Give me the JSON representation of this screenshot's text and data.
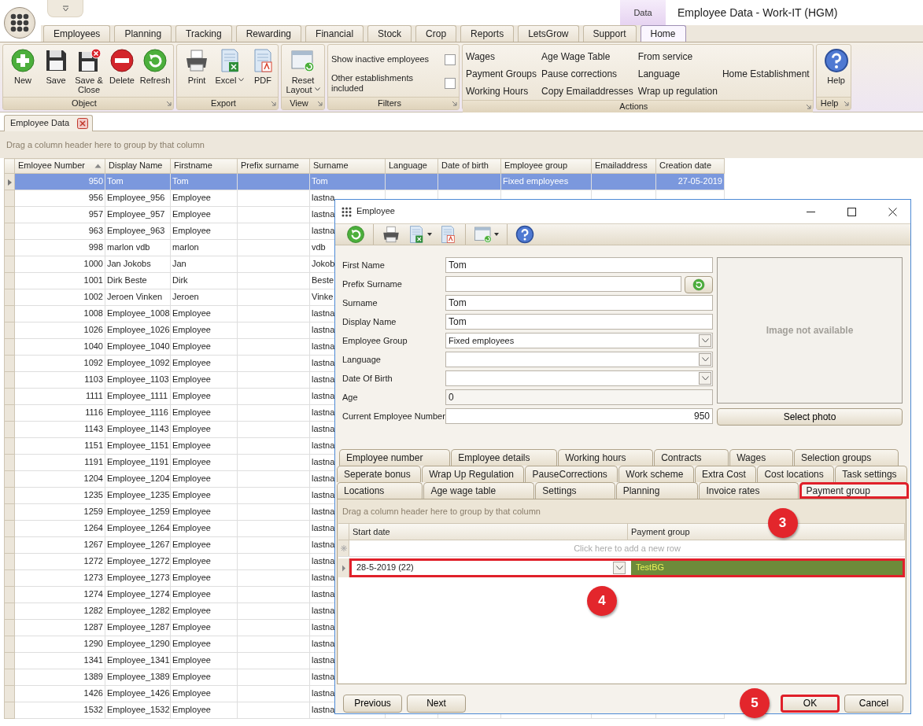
{
  "app": {
    "context_tab": "Data",
    "title": "Employee Data - Work-IT (HGM)"
  },
  "ribbon_tabs": [
    {
      "label": "Employees",
      "selected": false
    },
    {
      "label": "Planning",
      "selected": false
    },
    {
      "label": "Tracking",
      "selected": false
    },
    {
      "label": "Rewarding",
      "selected": false
    },
    {
      "label": "Financial",
      "selected": false
    },
    {
      "label": "Stock",
      "selected": false
    },
    {
      "label": "Crop",
      "selected": false
    },
    {
      "label": "Reports",
      "selected": false
    },
    {
      "label": "LetsGrow",
      "selected": false
    },
    {
      "label": "Support",
      "selected": false
    },
    {
      "label": "Home",
      "selected": true
    }
  ],
  "ribbon_groups": [
    {
      "kind": "buttons",
      "caption": "Object",
      "buttons": [
        {
          "label": "New",
          "dropdown": false
        },
        {
          "label": "Save",
          "dropdown": false
        },
        {
          "label": "Save & Close",
          "dropdown": false
        },
        {
          "label": "Delete",
          "dropdown": false
        },
        {
          "label": "Refresh",
          "dropdown": false
        }
      ]
    },
    {
      "kind": "buttons",
      "caption": "Export",
      "buttons": [
        {
          "label": "Print",
          "dropdown": false
        },
        {
          "label": "Excel",
          "dropdown": true
        },
        {
          "label": "PDF",
          "dropdown": false
        }
      ]
    },
    {
      "kind": "buttons",
      "caption": "View",
      "buttons": [
        {
          "label": "Reset Layout",
          "dropdown": true
        }
      ]
    },
    {
      "kind": "checks",
      "caption": "Filters",
      "options": [
        {
          "label": "Show inactive employees",
          "checked": false
        },
        {
          "label": "Other establishments included",
          "checked": false
        }
      ]
    },
    {
      "kind": "links",
      "caption": "Actions",
      "rows": [
        [
          "Wages",
          "Age Wage Table",
          "From service"
        ],
        [
          "Payment Groups",
          "Pause corrections",
          "Language",
          "Home Establishment"
        ],
        [
          "Working Hours",
          "Copy Emailaddresses",
          "Wrap up regulation"
        ]
      ]
    },
    {
      "kind": "buttons",
      "caption": "Help",
      "buttons": [
        {
          "label": "Help",
          "dropdown": false
        }
      ]
    }
  ],
  "document_tab": {
    "label": "Employee Data"
  },
  "grid": {
    "group_hint": "Drag a column header here to group by that column",
    "columns": [
      {
        "label": "Emloyee Number",
        "sorted": true
      },
      {
        "label": "Display Name",
        "sorted": false
      },
      {
        "label": "Firstname",
        "sorted": false
      },
      {
        "label": "Prefix surname",
        "sorted": false
      },
      {
        "label": "Surname",
        "sorted": false
      },
      {
        "label": "Language",
        "sorted": false
      },
      {
        "label": "Date of birth",
        "sorted": false
      },
      {
        "label": "Employee group",
        "sorted": false
      },
      {
        "label": "Emailaddress",
        "sorted": false
      },
      {
        "label": "Creation date",
        "sorted": false
      }
    ],
    "rows": [
      {
        "number": "950",
        "display_name": "Tom",
        "firstname": "Tom",
        "surname": "Tom",
        "employee_group": "Fixed employees",
        "creation_date": "27-05-2019",
        "selected": true
      },
      {
        "number": "956",
        "display_name": "Employee_956",
        "firstname": "Employee",
        "surname": "lastna",
        "selected": false
      },
      {
        "number": "957",
        "display_name": "Employee_957",
        "firstname": "Employee",
        "surname": "lastna",
        "selected": false
      },
      {
        "number": "963",
        "display_name": "Employee_963",
        "firstname": "Employee",
        "surname": "lastna",
        "selected": false
      },
      {
        "number": "998",
        "display_name": "marlon vdb",
        "firstname": "marlon",
        "surname": "vdb",
        "selected": false
      },
      {
        "number": "1000",
        "display_name": "Jan Jokobs",
        "firstname": "Jan",
        "surname": "Jokob",
        "selected": false
      },
      {
        "number": "1001",
        "display_name": "Dirk Beste",
        "firstname": "Dirk",
        "surname": "Beste",
        "selected": false
      },
      {
        "number": "1002",
        "display_name": "Jeroen Vinken",
        "firstname": "Jeroen",
        "surname": "Vinke",
        "selected": false
      },
      {
        "number": "1008",
        "display_name": "Employee_1008",
        "firstname": "Employee",
        "surname": "lastna",
        "selected": false
      },
      {
        "number": "1026",
        "display_name": "Employee_1026",
        "firstname": "Employee",
        "surname": "lastna",
        "selected": false
      },
      {
        "number": "1040",
        "display_name": "Employee_1040",
        "firstname": "Employee",
        "surname": "lastna",
        "selected": false
      },
      {
        "number": "1092",
        "display_name": "Employee_1092",
        "firstname": "Employee",
        "surname": "lastna",
        "selected": false
      },
      {
        "number": "1103",
        "display_name": "Employee_1103",
        "firstname": "Employee",
        "surname": "lastna",
        "selected": false
      },
      {
        "number": "1111",
        "display_name": "Employee_1111",
        "firstname": "Employee",
        "surname": "lastna",
        "selected": false
      },
      {
        "number": "1116",
        "display_name": "Employee_1116",
        "firstname": "Employee",
        "surname": "lastna",
        "selected": false
      },
      {
        "number": "1143",
        "display_name": "Employee_1143",
        "firstname": "Employee",
        "surname": "lastna",
        "selected": false
      },
      {
        "number": "1151",
        "display_name": "Employee_1151",
        "firstname": "Employee",
        "surname": "lastna",
        "selected": false
      },
      {
        "number": "1191",
        "display_name": "Employee_1191",
        "firstname": "Employee",
        "surname": "lastna",
        "selected": false
      },
      {
        "number": "1204",
        "display_name": "Employee_1204",
        "firstname": "Employee",
        "surname": "lastna",
        "selected": false
      },
      {
        "number": "1235",
        "display_name": "Employee_1235",
        "firstname": "Employee",
        "surname": "lastna",
        "selected": false
      },
      {
        "number": "1259",
        "display_name": "Employee_1259",
        "firstname": "Employee",
        "surname": "lastna",
        "selected": false
      },
      {
        "number": "1264",
        "display_name": "Employee_1264",
        "firstname": "Employee",
        "surname": "lastna",
        "selected": false
      },
      {
        "number": "1267",
        "display_name": "Employee_1267",
        "firstname": "Employee",
        "surname": "lastna",
        "selected": false
      },
      {
        "number": "1272",
        "display_name": "Employee_1272",
        "firstname": "Employee",
        "surname": "lastna",
        "selected": false
      },
      {
        "number": "1273",
        "display_name": "Employee_1273",
        "firstname": "Employee",
        "surname": "lastna",
        "selected": false
      },
      {
        "number": "1274",
        "display_name": "Employee_1274",
        "firstname": "Employee",
        "surname": "lastna",
        "selected": false
      },
      {
        "number": "1282",
        "display_name": "Employee_1282",
        "firstname": "Employee",
        "surname": "lastna",
        "selected": false
      },
      {
        "number": "1287",
        "display_name": "Employee_1287",
        "firstname": "Employee",
        "surname": "lastna",
        "selected": false
      },
      {
        "number": "1290",
        "display_name": "Employee_1290",
        "firstname": "Employee",
        "surname": "lastna",
        "selected": false
      },
      {
        "number": "1341",
        "display_name": "Employee_1341",
        "firstname": "Employee",
        "surname": "lastna",
        "selected": false
      },
      {
        "number": "1389",
        "display_name": "Employee_1389",
        "firstname": "Employee",
        "surname": "lastna",
        "selected": false
      },
      {
        "number": "1426",
        "display_name": "Employee_1426",
        "firstname": "Employee",
        "surname": "lastna",
        "selected": false
      },
      {
        "number": "1532",
        "display_name": "Employee_1532",
        "firstname": "Employee",
        "surname": "lastna",
        "selected": false
      }
    ]
  },
  "dialog": {
    "title": "Employee",
    "toolbar": [
      [
        {
          "dropdown": false
        }
      ],
      [
        {
          "dropdown": false
        },
        {
          "dropdown": true
        },
        {
          "dropdown": false
        }
      ],
      [
        {
          "dropdown": true
        }
      ],
      [
        {
          "dropdown": false
        }
      ]
    ],
    "fields": [
      {
        "label": "First Name",
        "value": "Tom",
        "kind": "text"
      },
      {
        "label": "Prefix Surname",
        "kind": "text_button"
      },
      {
        "label": "Surname",
        "value": "Tom",
        "kind": "text"
      },
      {
        "label": "Display Name",
        "value": "Tom",
        "kind": "text"
      },
      {
        "label": "Employee Group",
        "value": "Fixed employees",
        "kind": "dropdown"
      },
      {
        "label": "Language",
        "kind": "dropdown"
      },
      {
        "label": "Date Of Birth",
        "kind": "dropdown"
      },
      {
        "label": "Age",
        "value": "0",
        "kind": "readonly"
      },
      {
        "label": "Current Employee Number",
        "value": "950",
        "kind": "number"
      }
    ],
    "photo": {
      "placeholder": "Image not available",
      "button": "Select photo"
    },
    "tab_rows": [
      [
        {
          "label": "Employee number",
          "selected": false,
          "highlighted": false
        },
        {
          "label": "Employee details",
          "selected": false,
          "highlighted": false
        },
        {
          "label": "Working hours",
          "selected": false,
          "highlighted": false
        },
        {
          "label": "Contracts",
          "selected": false,
          "highlighted": false
        },
        {
          "label": "Wages",
          "selected": false,
          "highlighted": false
        },
        {
          "label": "Selection groups",
          "selected": false,
          "highlighted": false
        }
      ],
      [
        {
          "label": "Seperate bonus",
          "selected": false,
          "highlighted": false
        },
        {
          "label": "Wrap Up Regulation",
          "selected": false,
          "highlighted": false
        },
        {
          "label": "PauseCorrections",
          "selected": false,
          "highlighted": false
        },
        {
          "label": "Work scheme",
          "selected": false,
          "highlighted": false
        },
        {
          "label": "Extra Cost",
          "selected": false,
          "highlighted": false
        },
        {
          "label": "Cost locations",
          "selected": false,
          "highlighted": false
        },
        {
          "label": "Task settings",
          "selected": false,
          "highlighted": false
        }
      ],
      [
        {
          "label": "Locations",
          "selected": false,
          "highlighted": false
        },
        {
          "label": "Age wage table",
          "selected": false,
          "highlighted": false
        },
        {
          "label": "Settings",
          "selected": false,
          "highlighted": false
        },
        {
          "label": "Planning",
          "selected": false,
          "highlighted": false
        },
        {
          "label": "Invoice rates",
          "selected": false,
          "highlighted": false
        },
        {
          "label": "Payment group",
          "selected": true,
          "highlighted": true,
          "callout": "3"
        }
      ]
    ],
    "subgrid": {
      "group_hint": "Drag a column header here to group by that column",
      "columns": [
        "Start date",
        "Payment group"
      ],
      "new_row_hint": "Click here to add a new row",
      "rows": [
        {
          "start_date": "28-5-2019 (22)",
          "payment_group": "TestBG",
          "selected": true,
          "highlighted": true,
          "callout": "4"
        }
      ]
    },
    "buttons": [
      {
        "label": "Previous",
        "highlighted": false
      },
      {
        "label": "Next",
        "highlighted": false
      },
      {
        "label": "OK",
        "highlighted": true,
        "callout": "5"
      },
      {
        "label": "Cancel",
        "highlighted": false
      }
    ]
  }
}
